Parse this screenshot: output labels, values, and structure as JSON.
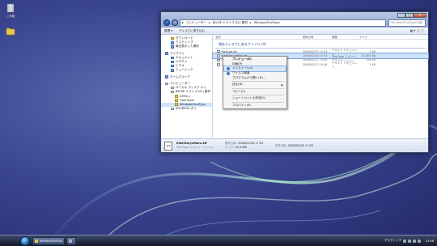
{
  "desktop": {
    "icons": [
      {
        "name": "ごみ箱"
      },
      {
        "name": ""
      }
    ]
  },
  "window": {
    "breadcrumb": [
      "コンピューター",
      "BD-RE ドライブ (D:) 素材",
      "WindowsTrueType"
    ],
    "search_placeholder": "WindowsTrueTypeの検索",
    "toolbar": {
      "organize": "整理 ▾",
      "share": "ディスクに書き込む"
    },
    "nav_pane": {
      "items": [
        {
          "label": "ダウンロード",
          "level": 1,
          "icon": "folder-icon"
        },
        {
          "label": "デスクトップ",
          "level": 1,
          "icon": "desktop-icon"
        },
        {
          "label": "最近表示した場所",
          "level": 1,
          "icon": "recent-icon"
        },
        {
          "label": "ライブラリ",
          "level": 0,
          "icon": "library-icon"
        },
        {
          "label": "ドキュメント",
          "level": 1,
          "icon": "documents-icon"
        },
        {
          "label": "ピクチャ",
          "level": 1,
          "icon": "pictures-icon"
        },
        {
          "label": "ビデオ",
          "level": 1,
          "icon": "video-icon"
        },
        {
          "label": "ミュージック",
          "level": 1,
          "icon": "music-icon"
        },
        {
          "label": "ホームグループ",
          "level": 0,
          "icon": "homegroup-icon"
        },
        {
          "label": "コンピューター",
          "level": 0,
          "icon": "computer-icon"
        },
        {
          "label": "ローカル ディスク (C:)",
          "level": 1,
          "icon": "disk-icon"
        },
        {
          "label": "BD-RE ドライブ (D:) 素材",
          "level": 1,
          "icon": "disc-icon"
        },
        {
          "label": "ATM4.1",
          "level": 2,
          "icon": "folder-icon"
        },
        {
          "label": "OpenType",
          "level": 2,
          "icon": "folder-icon"
        },
        {
          "label": "WindowsTrueType",
          "level": 2,
          "icon": "folder-icon",
          "selected": true
        },
        {
          "label": "KOUDEV4 (E:)",
          "level": 1,
          "icon": "drive-icon"
        }
      ]
    },
    "columns": [
      "名前",
      "更新日時",
      "種類",
      "サイズ"
    ],
    "group_header": "現在ディスクにあるファイル (4)",
    "files": [
      {
        "name": "FontLab.txt",
        "date": "2008/02/27 12:33",
        "type": "テキスト ドキュメント",
        "size": "1 KB"
      },
      {
        "name": "KikeiGaryuMaru.ttf",
        "date": "2008/02/28 17:03",
        "type": "TrueType フォント",
        "size": "20,000 KB",
        "selected": true
      },
      {
        "name": "Setup.exe",
        "date": "2008/02/27 13:45",
        "type": "アプリケーション",
        "size": "339 KB"
      },
      {
        "name": "まずお読みください.txt",
        "date": "2008/02/27 14:38",
        "type": "テキスト ドキュメント",
        "size": "3 KB"
      }
    ],
    "details": {
      "filename": "KikeiGaryuMaru.ttf",
      "filetype": "TrueType フォント ファイル",
      "modified_label": "更新日時:",
      "modified": "2008/02/28 17:03",
      "size_label": "サイズ:",
      "size": "20.3 MB",
      "created_label": "作成日時:",
      "created": "2008/02/28 17:03"
    }
  },
  "context_menu": {
    "items": [
      {
        "label": "プレビュー(E)",
        "bold": true
      },
      {
        "label": "印刷(P)"
      },
      {
        "label": "インストール(I)",
        "hover": true,
        "shield": true
      },
      {
        "label": "ウイルス検査",
        "shield": true
      },
      {
        "label": "プログラムから開く(H)..."
      },
      {
        "sep": true
      },
      {
        "label": "送る(N)",
        "submenu": true
      },
      {
        "sep": true
      },
      {
        "label": "コピー(C)"
      },
      {
        "sep": true
      },
      {
        "label": "ショートカットの作成(S)"
      },
      {
        "sep": true
      },
      {
        "label": "プロパティ(R)"
      }
    ]
  },
  "taskbar": {
    "tasks": [
      {
        "label": "WindowsTrueType"
      },
      {
        "label": ""
      }
    ],
    "tray": {
      "desktop_label": "デスクトップ",
      "time": "23:46"
    }
  },
  "colors": {
    "wallpaper": "#3a4590",
    "accent": "#3b78d4",
    "selection": "#cde2fb"
  }
}
